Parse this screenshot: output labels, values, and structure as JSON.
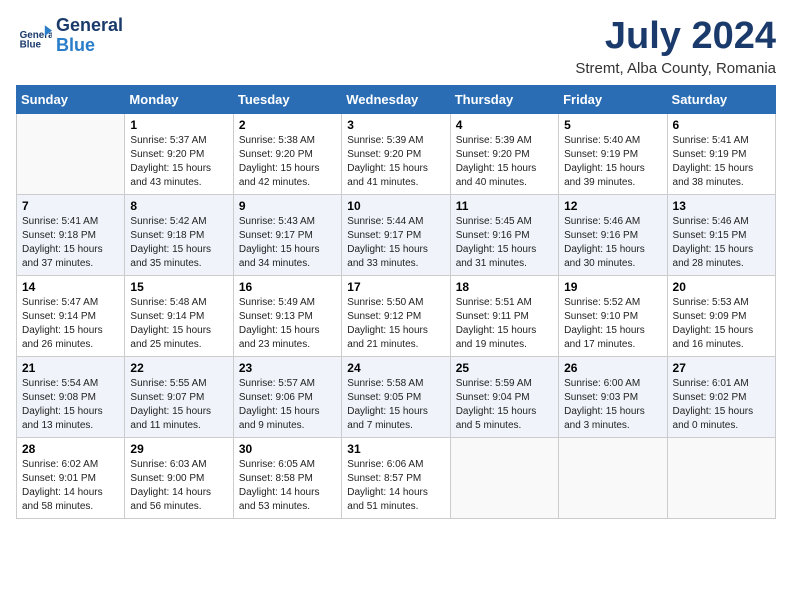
{
  "header": {
    "logo_line1": "General",
    "logo_line2": "Blue",
    "month_title": "July 2024",
    "location": "Stremt, Alba County, Romania"
  },
  "weekdays": [
    "Sunday",
    "Monday",
    "Tuesday",
    "Wednesday",
    "Thursday",
    "Friday",
    "Saturday"
  ],
  "weeks": [
    [
      {
        "day": "",
        "info": ""
      },
      {
        "day": "1",
        "info": "Sunrise: 5:37 AM\nSunset: 9:20 PM\nDaylight: 15 hours\nand 43 minutes."
      },
      {
        "day": "2",
        "info": "Sunrise: 5:38 AM\nSunset: 9:20 PM\nDaylight: 15 hours\nand 42 minutes."
      },
      {
        "day": "3",
        "info": "Sunrise: 5:39 AM\nSunset: 9:20 PM\nDaylight: 15 hours\nand 41 minutes."
      },
      {
        "day": "4",
        "info": "Sunrise: 5:39 AM\nSunset: 9:20 PM\nDaylight: 15 hours\nand 40 minutes."
      },
      {
        "day": "5",
        "info": "Sunrise: 5:40 AM\nSunset: 9:19 PM\nDaylight: 15 hours\nand 39 minutes."
      },
      {
        "day": "6",
        "info": "Sunrise: 5:41 AM\nSunset: 9:19 PM\nDaylight: 15 hours\nand 38 minutes."
      }
    ],
    [
      {
        "day": "7",
        "info": "Sunrise: 5:41 AM\nSunset: 9:18 PM\nDaylight: 15 hours\nand 37 minutes."
      },
      {
        "day": "8",
        "info": "Sunrise: 5:42 AM\nSunset: 9:18 PM\nDaylight: 15 hours\nand 35 minutes."
      },
      {
        "day": "9",
        "info": "Sunrise: 5:43 AM\nSunset: 9:17 PM\nDaylight: 15 hours\nand 34 minutes."
      },
      {
        "day": "10",
        "info": "Sunrise: 5:44 AM\nSunset: 9:17 PM\nDaylight: 15 hours\nand 33 minutes."
      },
      {
        "day": "11",
        "info": "Sunrise: 5:45 AM\nSunset: 9:16 PM\nDaylight: 15 hours\nand 31 minutes."
      },
      {
        "day": "12",
        "info": "Sunrise: 5:46 AM\nSunset: 9:16 PM\nDaylight: 15 hours\nand 30 minutes."
      },
      {
        "day": "13",
        "info": "Sunrise: 5:46 AM\nSunset: 9:15 PM\nDaylight: 15 hours\nand 28 minutes."
      }
    ],
    [
      {
        "day": "14",
        "info": "Sunrise: 5:47 AM\nSunset: 9:14 PM\nDaylight: 15 hours\nand 26 minutes."
      },
      {
        "day": "15",
        "info": "Sunrise: 5:48 AM\nSunset: 9:14 PM\nDaylight: 15 hours\nand 25 minutes."
      },
      {
        "day": "16",
        "info": "Sunrise: 5:49 AM\nSunset: 9:13 PM\nDaylight: 15 hours\nand 23 minutes."
      },
      {
        "day": "17",
        "info": "Sunrise: 5:50 AM\nSunset: 9:12 PM\nDaylight: 15 hours\nand 21 minutes."
      },
      {
        "day": "18",
        "info": "Sunrise: 5:51 AM\nSunset: 9:11 PM\nDaylight: 15 hours\nand 19 minutes."
      },
      {
        "day": "19",
        "info": "Sunrise: 5:52 AM\nSunset: 9:10 PM\nDaylight: 15 hours\nand 17 minutes."
      },
      {
        "day": "20",
        "info": "Sunrise: 5:53 AM\nSunset: 9:09 PM\nDaylight: 15 hours\nand 16 minutes."
      }
    ],
    [
      {
        "day": "21",
        "info": "Sunrise: 5:54 AM\nSunset: 9:08 PM\nDaylight: 15 hours\nand 13 minutes."
      },
      {
        "day": "22",
        "info": "Sunrise: 5:55 AM\nSunset: 9:07 PM\nDaylight: 15 hours\nand 11 minutes."
      },
      {
        "day": "23",
        "info": "Sunrise: 5:57 AM\nSunset: 9:06 PM\nDaylight: 15 hours\nand 9 minutes."
      },
      {
        "day": "24",
        "info": "Sunrise: 5:58 AM\nSunset: 9:05 PM\nDaylight: 15 hours\nand 7 minutes."
      },
      {
        "day": "25",
        "info": "Sunrise: 5:59 AM\nSunset: 9:04 PM\nDaylight: 15 hours\nand 5 minutes."
      },
      {
        "day": "26",
        "info": "Sunrise: 6:00 AM\nSunset: 9:03 PM\nDaylight: 15 hours\nand 3 minutes."
      },
      {
        "day": "27",
        "info": "Sunrise: 6:01 AM\nSunset: 9:02 PM\nDaylight: 15 hours\nand 0 minutes."
      }
    ],
    [
      {
        "day": "28",
        "info": "Sunrise: 6:02 AM\nSunset: 9:01 PM\nDaylight: 14 hours\nand 58 minutes."
      },
      {
        "day": "29",
        "info": "Sunrise: 6:03 AM\nSunset: 9:00 PM\nDaylight: 14 hours\nand 56 minutes."
      },
      {
        "day": "30",
        "info": "Sunrise: 6:05 AM\nSunset: 8:58 PM\nDaylight: 14 hours\nand 53 minutes."
      },
      {
        "day": "31",
        "info": "Sunrise: 6:06 AM\nSunset: 8:57 PM\nDaylight: 14 hours\nand 51 minutes."
      },
      {
        "day": "",
        "info": ""
      },
      {
        "day": "",
        "info": ""
      },
      {
        "day": "",
        "info": ""
      }
    ]
  ]
}
